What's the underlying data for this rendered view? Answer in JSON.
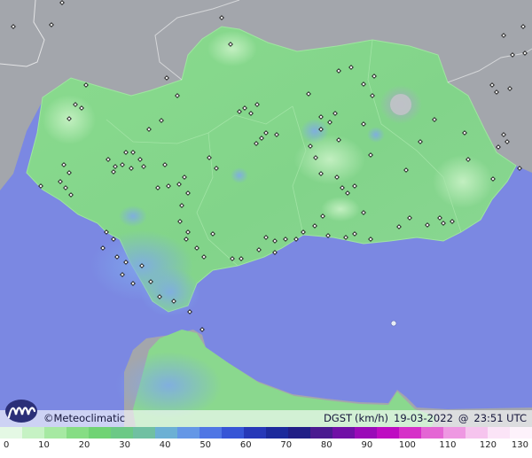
{
  "map": {
    "credit_symbol": "©",
    "credit_label": "Meteoclimatic",
    "variable": "DGST",
    "units": "(km/h)",
    "date": "19-03-2022",
    "at": "@",
    "time": "23:51 UTC"
  },
  "legend": {
    "ticks": [
      "0",
      "10",
      "20",
      "30",
      "40",
      "50",
      "60",
      "70",
      "80",
      "90",
      "100",
      "110",
      "120",
      "130"
    ],
    "colors": [
      "#e4f8e4",
      "#c6f2c4",
      "#a6e9a2",
      "#86dd84",
      "#70d374",
      "#6cc986",
      "#70c0a2",
      "#6cb0d4",
      "#6497e6",
      "#4f76e4",
      "#3655d6",
      "#2638b8",
      "#1c2a9c",
      "#201e86",
      "#4a1a90",
      "#7010a6",
      "#9a0ab8",
      "#be0cc2",
      "#d630c8",
      "#e466d4",
      "#ee98e2",
      "#f6c4ee",
      "#fbe4f7",
      "#fdf2fb"
    ]
  },
  "colors": {
    "sea": "#7b88e2",
    "land_foreign": "#a3a6ac",
    "land_region": "#8ada8c",
    "wind_accent": "#6b9be8",
    "station": "#1a1a1a"
  },
  "icons": [
    "meteoclimatic-logo-icon",
    "station-marker-icon"
  ]
}
